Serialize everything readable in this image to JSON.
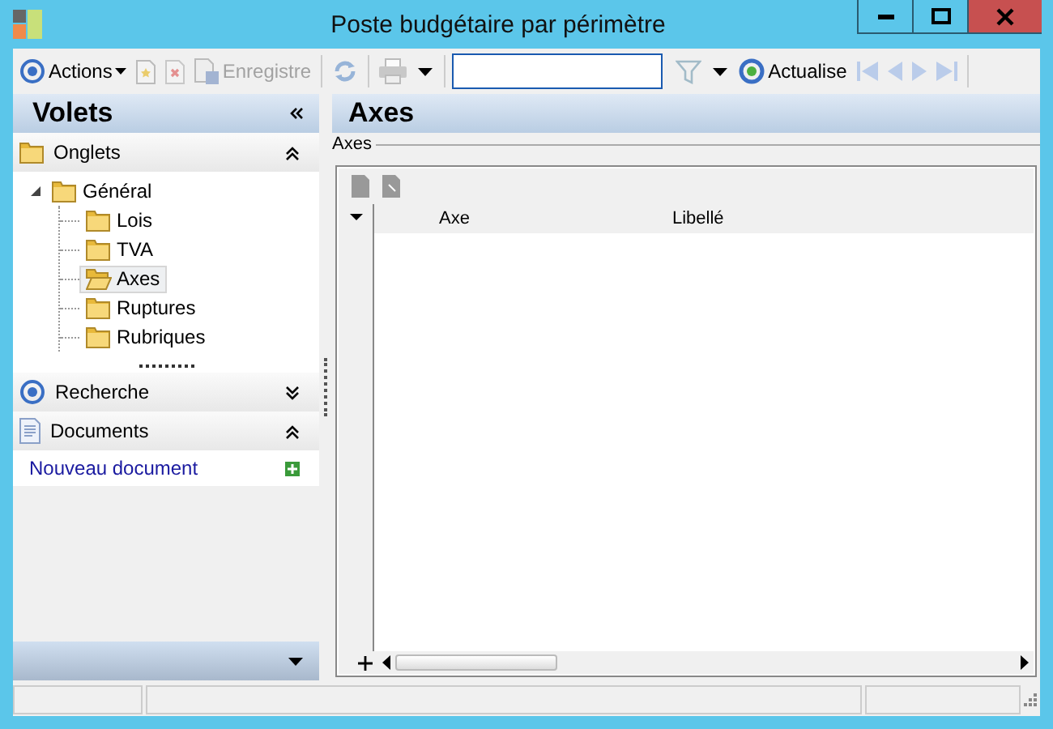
{
  "window": {
    "title": "Poste budgétaire par périmètre"
  },
  "toolbar": [
    {
      "kind": "actions",
      "label": "Actions",
      "disabled": false
    },
    {
      "kind": "new",
      "disabled": true
    },
    {
      "kind": "delete",
      "disabled": true
    },
    {
      "kind": "save",
      "label": "Enregistre",
      "disabled": true
    },
    {
      "kind": "sep"
    },
    {
      "kind": "refresh",
      "disabled": true
    },
    {
      "kind": "sep"
    },
    {
      "kind": "print",
      "disabled": true
    },
    {
      "kind": "dropdown",
      "disabled": false
    },
    {
      "kind": "sep"
    },
    {
      "kind": "search"
    },
    {
      "kind": "filter",
      "disabled": true
    },
    {
      "kind": "dropdown",
      "disabled": false
    },
    {
      "kind": "reload",
      "label": "Actualise",
      "disabled": false
    },
    {
      "kind": "first",
      "disabled": true
    },
    {
      "kind": "prev",
      "disabled": true
    },
    {
      "kind": "next",
      "disabled": true
    },
    {
      "kind": "last",
      "disabled": true
    },
    {
      "kind": "sep"
    }
  ],
  "sidebar": {
    "title": "Volets",
    "sections": [
      {
        "title": "Onglets",
        "expanded": true,
        "tree": [
          {
            "label": "Général",
            "expanded": true,
            "selected": false,
            "children": [
              {
                "label": "Lois",
                "selected": false
              },
              {
                "label": "TVA",
                "selected": false
              },
              {
                "label": "Axes",
                "selected": true
              },
              {
                "label": "Ruptures",
                "selected": false
              },
              {
                "label": "Rubriques",
                "selected": false
              }
            ]
          }
        ]
      },
      {
        "title": "Recherche",
        "expanded": false
      },
      {
        "title": "Documents",
        "expanded": true,
        "links": [
          "Nouveau document"
        ]
      }
    ]
  },
  "content": {
    "title": "Axes",
    "group": "Axes",
    "grid": {
      "columns": [
        "Axe",
        "Libellé"
      ]
    }
  }
}
